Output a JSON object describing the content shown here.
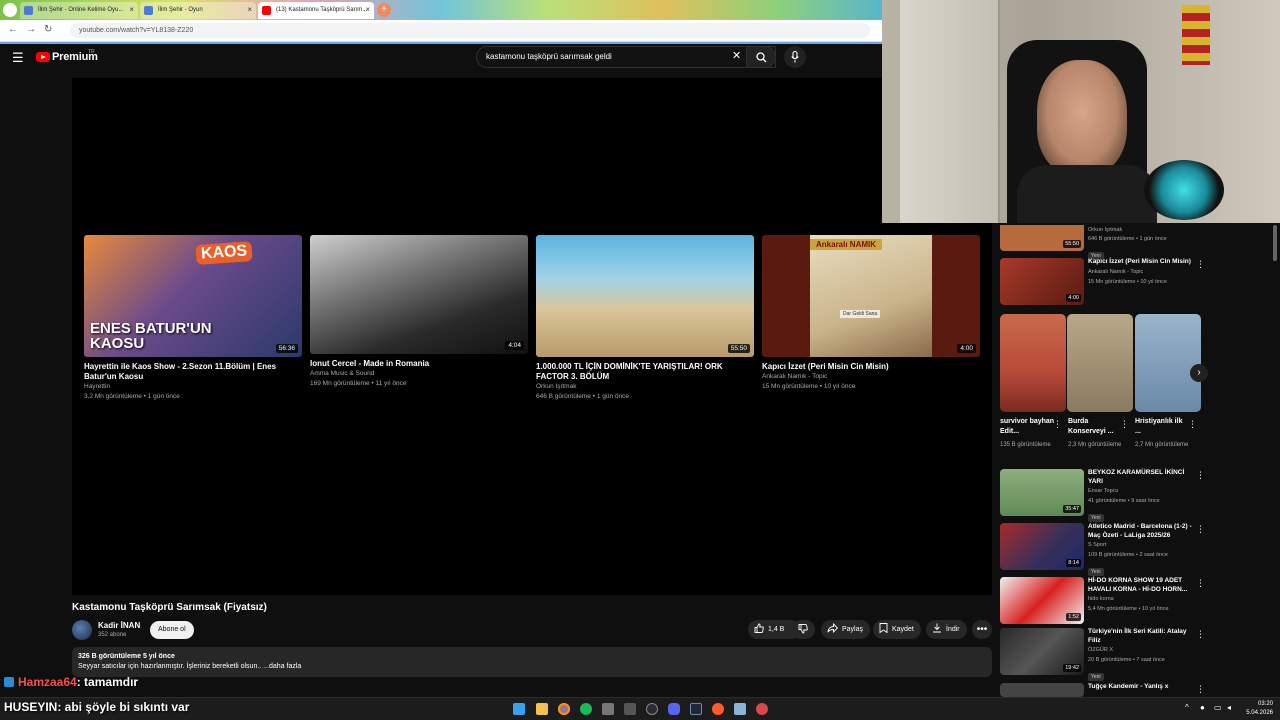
{
  "browser": {
    "tabs": [
      {
        "label": "İlim Şehir - Online Kelime Oyu...",
        "color": "#4e7ad3"
      },
      {
        "label": "İlim Şehir - Oyun",
        "color": "#4e7ad3"
      },
      {
        "label": "(13) Kastamonu Taşköprü Sarım...",
        "color": "#ff0000"
      }
    ],
    "url": "youtube.com/watch?v=YL8138-Z220"
  },
  "header": {
    "brand": "Premium",
    "brand_sup": "TR",
    "search_query": "kastamonu taşköprü sarımsak geldi"
  },
  "end_cards": [
    {
      "title": "Hayrettin ile Kaos Show - 2.Sezon 11.Bölüm | Enes Batur'un Kaosu",
      "channel": "Hayrettin",
      "meta": "3,2 Mn görüntüleme • 1 gün önce",
      "duration": "56:36",
      "overlay": "ENES BATUR'UN KAOSU",
      "logo": "KAOS"
    },
    {
      "title": "Ionut Cercel - Made in Romania",
      "channel": "Amma Music & Sound",
      "meta": "169 Mn görüntüleme • 11 yıl önce",
      "duration": "4:04"
    },
    {
      "title": "1.000.000 TL İÇİN DOMİNİK'TE YARIŞTILAR! ORK FACTOR 3. BÖLÜM",
      "channel": "Orkun Işıtmak",
      "meta": "646 B görüntüleme • 1 gün önce",
      "duration": "55:50"
    },
    {
      "title": "Kapıcı İzzet (Peri Misin Cin Misin)",
      "channel": "Ankaralı Namık - Topic",
      "meta": "15 Mn görüntüleme • 10 yıl önce",
      "duration": "4:00",
      "overlay": "Ankaralı NAMIK",
      "album": "Dar Geldi Sana"
    }
  ],
  "video": {
    "title": "Kastamonu Taşköprü Sarımsak (Fiyatsız)",
    "channel": "Kadir İNAN",
    "subs": "352 abone",
    "subscribe": "Abone ol",
    "likes": "1,4 B",
    "share": "Paylaş",
    "save": "Kaydet",
    "download": "İndir",
    "stats": "326 B görüntüleme  5 yıl önce",
    "description": "Seyyar satıcılar için hazırlanmıştır. İşleriniz bereketli olsun.. ...daha fazla"
  },
  "sidebar": {
    "items": [
      {
        "title": "",
        "channel": "Orkun Işıtmak",
        "meta": "646 B görüntüleme • 1 gün önce",
        "badge": "Yeni",
        "duration": "55:50",
        "color": "#b76a3c"
      },
      {
        "title": "Kapıcı İzzet (Peri Misin Cin Misin)",
        "channel": "Ankaralı Namık - Topic",
        "meta": "15 Mn görüntüleme • 10 yıl önce",
        "badge": "",
        "duration": "4:00",
        "color": "#8a2a2a"
      },
      {
        "title": "BEYKOZ KARAMÜRSEL İKİNCİ YARI",
        "channel": "Ensar Topcu",
        "meta": "41 görüntüleme • 9 saat önce",
        "badge": "Yeni",
        "duration": "35:47",
        "color": "#5f8a55"
      },
      {
        "title": "Atletico Madrid - Barcelona (1-2) - Maç Özeti - LaLiga 2025/26",
        "channel": "S Sport",
        "meta": "109 B görüntüleme • 2 saat önce",
        "badge": "Yeni",
        "duration": "8:14",
        "color": "#3a2f58"
      },
      {
        "title": "Hİ-DO KORNA SHOW 19 ADET HAVALI KORNA - Hİ-DO HORN...",
        "channel": "hido korna",
        "meta": "5,4 Mn görüntüleme • 10 yıl önce",
        "badge": "",
        "duration": "1:52",
        "color": "#d9d9d9"
      },
      {
        "title": "Türkiye'nin İlk Seri Katili: Atalay Filiz",
        "channel": "ÖZGÜR X",
        "meta": "20 B görüntüleme • 7 saat önce",
        "badge": "Yeni",
        "duration": "19:42",
        "color": "#3b3b3b"
      },
      {
        "title": "Tuğçe Kandemir - Yanlış x",
        "channel": "",
        "meta": "",
        "badge": "",
        "duration": "",
        "color": "#444"
      }
    ],
    "shorts": [
      {
        "title": "survivor bayhan Edit...",
        "meta": "135 B görüntüleme",
        "color": "#b84a3a"
      },
      {
        "title": "Burda Konserveyi ...",
        "meta": "2,3 Mn görüntüleme",
        "color": "#8a7a60"
      },
      {
        "title": "Hristiyanlık ilk ...",
        "meta": "2,7 Mn görüntüleme",
        "color": "#6a8aa8"
      }
    ]
  },
  "chat": [
    {
      "user": "Hamzaa64",
      "message": ": tamamdır"
    },
    {
      "user": "HUSEYIN",
      "message": ": abi şöyle bi sıkıntı var"
    }
  ],
  "taskbar": {
    "time": "03:20",
    "date": "5.04.2026"
  }
}
